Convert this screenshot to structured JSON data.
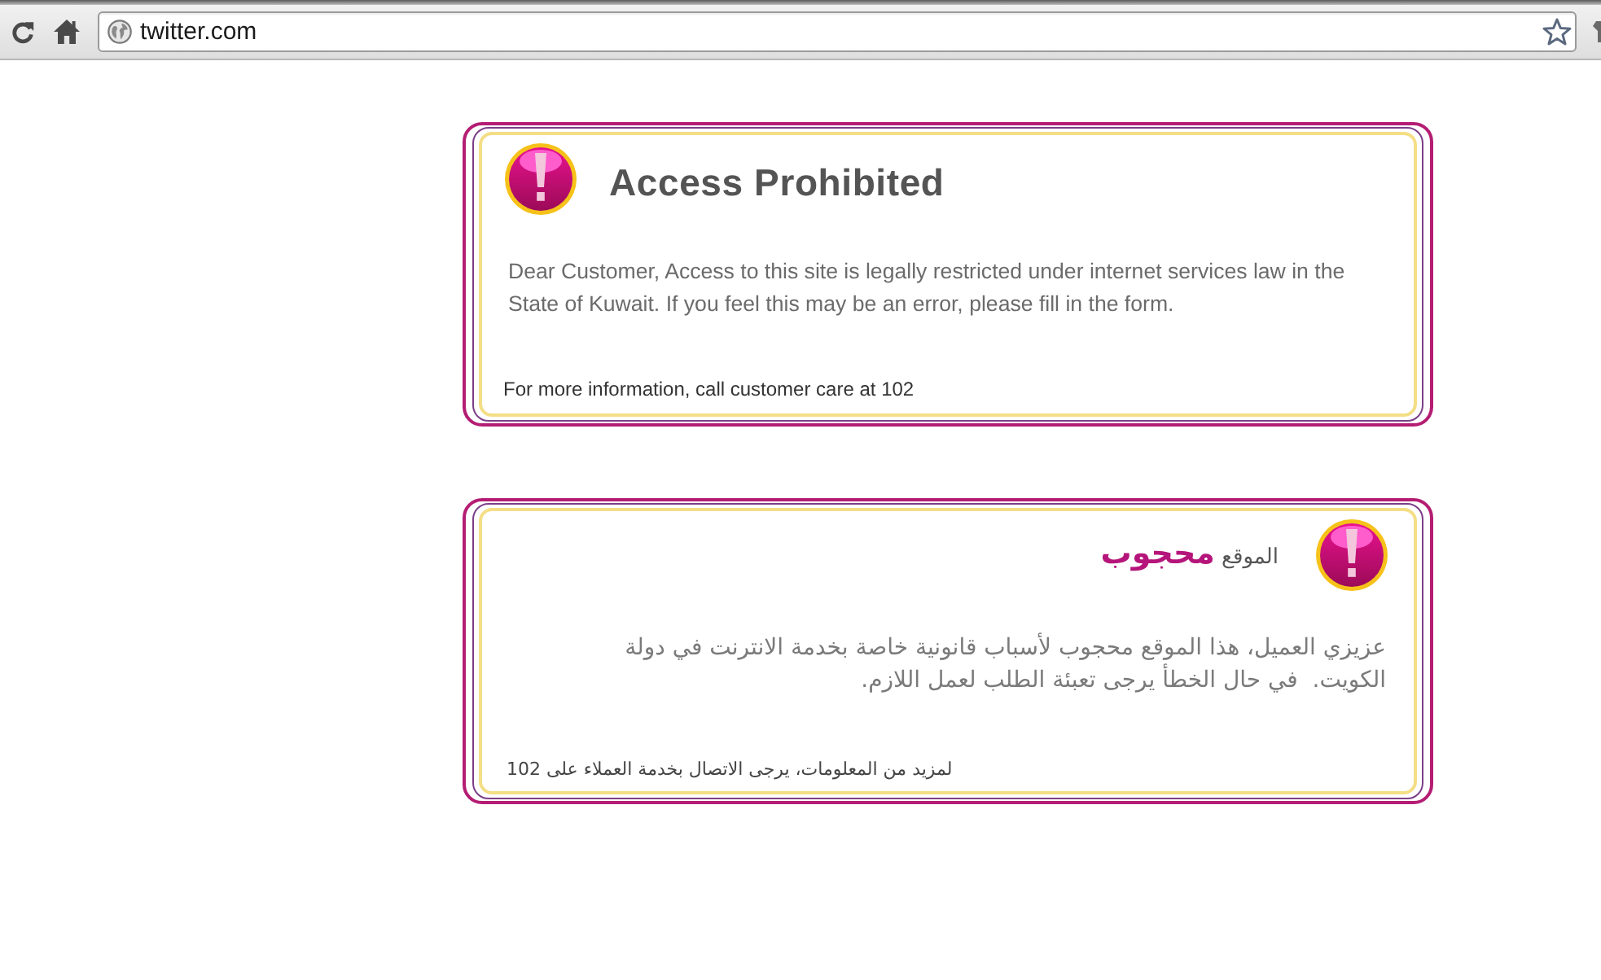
{
  "browser": {
    "address": "twitter.com"
  },
  "notices": [
    {
      "kind": "english",
      "title": "Access Prohibited",
      "message": "Dear Customer, Access to this site is legally restricted under internet services law in the State of Kuwait. If you feel this may be an error, please fill in the form.",
      "footer": "For more information, call customer care at 102"
    },
    {
      "kind": "arabic",
      "title": "الموقع **محجوب**",
      "message": "عزيزي العميل، هذا الموقع محجوب لأسباب قانونية خاصة بخدمة الانترنت في دولة الكويت.  في حال الخطأ يرجى تعبئة الطلب لعمل اللازم.",
      "footer": "لمزيد من المعلومات، يرجى الاتصال بخدمة العملاء على 102"
    }
  ]
}
